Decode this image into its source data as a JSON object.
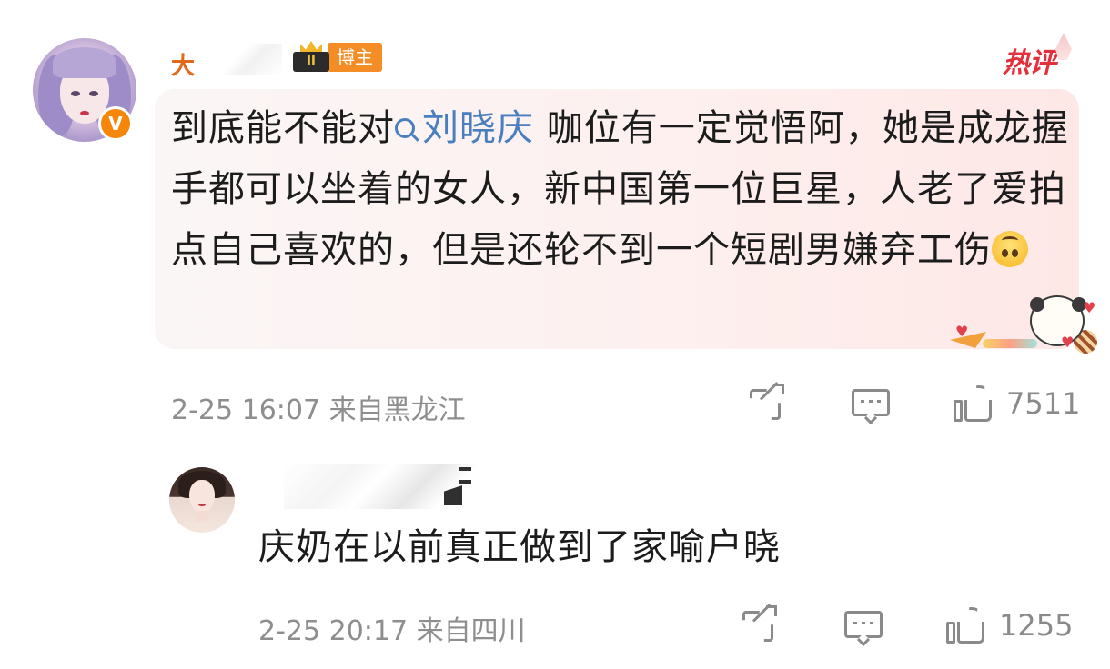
{
  "main_comment": {
    "username": "大",
    "badge_level": "II",
    "badge_label": "博主",
    "hot_tag": "热评",
    "text_before": "到底能不能对",
    "mention": "刘晓庆",
    "text_after": " 咖位有一定觉悟阿，她是成龙握手都可以坐着的女人，新中国第一位巨星，人老了爱拍点自己喜欢的，但是还轮不到一个短剧男嫌弃工伤",
    "emoji": "upside-down-face",
    "verified_mark": "V",
    "time": "2-25 16:07",
    "location": "来自黑龙江",
    "like_count": "7511"
  },
  "reply": {
    "text": "庆奶在以前真正做到了家喻户晓",
    "time": "2-25 20:17",
    "location": "来自四川",
    "like_count": "1255"
  },
  "colors": {
    "username": "#e06a1a",
    "mention": "#4a7fbf",
    "meta": "#8e8e8e",
    "hot_tag": "#e2303c",
    "badge": "#f58d27",
    "verified": "#f5860a"
  },
  "icons": [
    "search-icon",
    "share-icon",
    "comment-icon",
    "like-icon"
  ]
}
